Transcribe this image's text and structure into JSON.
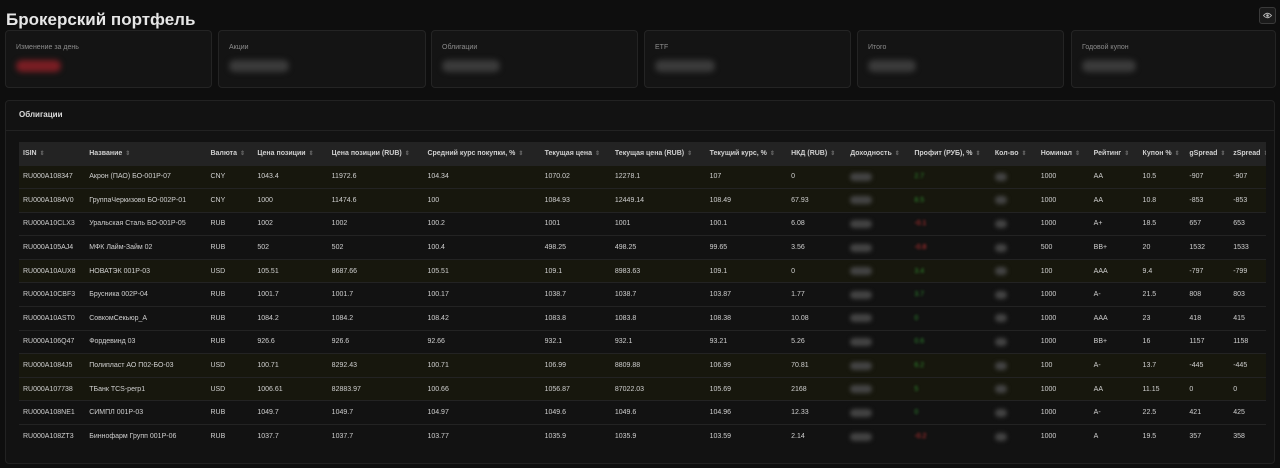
{
  "page": {
    "title": "Брокерский портфель"
  },
  "cards": [
    {
      "label": "Изменение за день"
    },
    {
      "label": "Акции"
    },
    {
      "label": "Облигации"
    },
    {
      "label": "ETF"
    },
    {
      "label": "Итого"
    },
    {
      "label": "Годовой купон"
    }
  ],
  "bonds": {
    "title": "Облигации",
    "columns": [
      "ISIN",
      "Название",
      "Валюта",
      "Цена позиции",
      "Цена позиции (RUB)",
      "Средний курс покупки, %",
      "Текущая цена",
      "Текущая цена (RUB)",
      "Текущий курс, %",
      "НКД (RUB)",
      "Доходность",
      "Профит (РУБ), %",
      "Кол-во",
      "Номинал",
      "Рейтинг",
      "Купон %",
      "gSpread",
      "zSpread"
    ],
    "rows": [
      {
        "isin": "RU000A108347",
        "name": "Акрон (ПАО) БО-001Р-07",
        "currency": "CNY",
        "pos_price": "1043.4",
        "pos_price_rub": "11972.6",
        "avg_buy": "104.34",
        "cur_price": "1070.02",
        "cur_price_rub": "12278.1",
        "cur_rate": "107",
        "nkd": "0",
        "profit": "2.7",
        "nominal": "1000",
        "rating": "AA",
        "coupon": "10.5",
        "gspread": "-907",
        "zspread": "-907"
      },
      {
        "isin": "RU000A1084V0",
        "name": "ГруппаЧеркизово БО-002Р-01",
        "currency": "CNY",
        "pos_price": "1000",
        "pos_price_rub": "11474.6",
        "avg_buy": "100",
        "cur_price": "1084.93",
        "cur_price_rub": "12449.14",
        "cur_rate": "108.49",
        "nkd": "67.93",
        "profit": "8.5",
        "nominal": "1000",
        "rating": "AA",
        "coupon": "10.8",
        "gspread": "-853",
        "zspread": "-853"
      },
      {
        "isin": "RU000A10CLX3",
        "name": "Уральская Сталь БО-001Р-05",
        "currency": "RUB",
        "pos_price": "1002",
        "pos_price_rub": "1002",
        "avg_buy": "100.2",
        "cur_price": "1001",
        "cur_price_rub": "1001",
        "cur_rate": "100.1",
        "nkd": "6.08",
        "profit": "-0.1",
        "nominal": "1000",
        "rating": "A+",
        "coupon": "18.5",
        "gspread": "657",
        "zspread": "653"
      },
      {
        "isin": "RU000A105AJ4",
        "name": "МФК Лайм-Займ 02",
        "currency": "RUB",
        "pos_price": "502",
        "pos_price_rub": "502",
        "avg_buy": "100.4",
        "cur_price": "498.25",
        "cur_price_rub": "498.25",
        "cur_rate": "99.65",
        "nkd": "3.56",
        "profit": "-0.8",
        "nominal": "500",
        "rating": "BB+",
        "coupon": "20",
        "gspread": "1532",
        "zspread": "1533"
      },
      {
        "isin": "RU000A10AUX8",
        "name": "НОВАТЭК 001Р-03",
        "currency": "USD",
        "pos_price": "105.51",
        "pos_price_rub": "8687.66",
        "avg_buy": "105.51",
        "cur_price": "109.1",
        "cur_price_rub": "8983.63",
        "cur_rate": "109.1",
        "nkd": "0",
        "profit": "3.4",
        "nominal": "100",
        "rating": "AAA",
        "coupon": "9.4",
        "gspread": "-797",
        "zspread": "-799"
      },
      {
        "isin": "RU000A10CBF3",
        "name": "Брусника 002Р-04",
        "currency": "RUB",
        "pos_price": "1001.7",
        "pos_price_rub": "1001.7",
        "avg_buy": "100.17",
        "cur_price": "1038.7",
        "cur_price_rub": "1038.7",
        "cur_rate": "103.87",
        "nkd": "1.77",
        "profit": "3.7",
        "nominal": "1000",
        "rating": "A-",
        "coupon": "21.5",
        "gspread": "808",
        "zspread": "803"
      },
      {
        "isin": "RU000A10AST0",
        "name": "СовкомСекьюр_А",
        "currency": "RUB",
        "pos_price": "1084.2",
        "pos_price_rub": "1084.2",
        "avg_buy": "108.42",
        "cur_price": "1083.8",
        "cur_price_rub": "1083.8",
        "cur_rate": "108.38",
        "nkd": "10.08",
        "profit": "0",
        "nominal": "1000",
        "rating": "AAA",
        "coupon": "23",
        "gspread": "418",
        "zspread": "415"
      },
      {
        "isin": "RU000A106Q47",
        "name": "Фордевинд 03",
        "currency": "RUB",
        "pos_price": "926.6",
        "pos_price_rub": "926.6",
        "avg_buy": "92.66",
        "cur_price": "932.1",
        "cur_price_rub": "932.1",
        "cur_rate": "93.21",
        "nkd": "5.26",
        "profit": "0.6",
        "nominal": "1000",
        "rating": "BB+",
        "coupon": "16",
        "gspread": "1157",
        "zspread": "1158"
      },
      {
        "isin": "RU000A1084J5",
        "name": "Полипласт АО П02-БО-03",
        "currency": "USD",
        "pos_price": "100.71",
        "pos_price_rub": "8292.43",
        "avg_buy": "100.71",
        "cur_price": "106.99",
        "cur_price_rub": "8809.88",
        "cur_rate": "106.99",
        "nkd": "70.81",
        "profit": "6.2",
        "nominal": "100",
        "rating": "A-",
        "coupon": "13.7",
        "gspread": "-445",
        "zspread": "-445"
      },
      {
        "isin": "RU000A107738",
        "name": "ТБанк TCS-perp1",
        "currency": "USD",
        "pos_price": "1006.61",
        "pos_price_rub": "82883.97",
        "avg_buy": "100.66",
        "cur_price": "1056.87",
        "cur_price_rub": "87022.03",
        "cur_rate": "105.69",
        "nkd": "2168",
        "profit": "5",
        "nominal": "1000",
        "rating": "AA",
        "coupon": "11.15",
        "gspread": "0",
        "zspread": "0"
      },
      {
        "isin": "RU000A108NE1",
        "name": "СИМПЛ 001Р-03",
        "currency": "RUB",
        "pos_price": "1049.7",
        "pos_price_rub": "1049.7",
        "avg_buy": "104.97",
        "cur_price": "1049.6",
        "cur_price_rub": "1049.6",
        "cur_rate": "104.96",
        "nkd": "12.33",
        "profit": "0",
        "nominal": "1000",
        "rating": "A-",
        "coupon": "22.5",
        "gspread": "421",
        "zspread": "425"
      },
      {
        "isin": "RU000A108ZT3",
        "name": "Биннофарм Групп 001Р-06",
        "currency": "RUB",
        "pos_price": "1037.7",
        "pos_price_rub": "1037.7",
        "avg_buy": "103.77",
        "cur_price": "1035.9",
        "cur_price_rub": "1035.9",
        "cur_rate": "103.59",
        "nkd": "2.14",
        "profit": "-0.2",
        "nominal": "1000",
        "rating": "A",
        "coupon": "19.5",
        "gspread": "357",
        "zspread": "358"
      }
    ]
  },
  "colors": {
    "background": "#0e0e0e",
    "profit_positive": "#2e8b2e",
    "profit_negative": "#d23636",
    "highlight_row": "#17170d"
  },
  "icons": {
    "visibility_toggle": "eye-icon"
  }
}
